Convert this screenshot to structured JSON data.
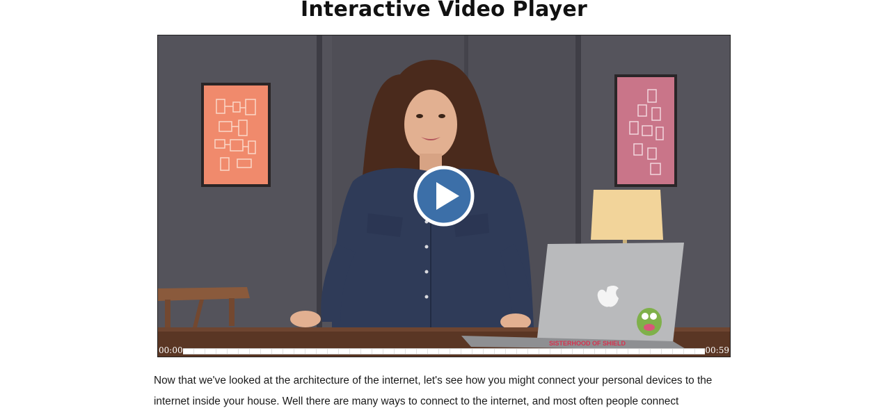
{
  "page": {
    "title": "Interactive Video Player"
  },
  "player": {
    "time_current": "00:00",
    "time_total": "00:59",
    "progress_fraction": 0,
    "play_icon": "play-icon",
    "sticker_text": "SISTERHOOD OF SHIELD"
  },
  "transcript": {
    "text": "Now that we've looked at the architecture of the internet, let's see how you might connect your personal devices to the internet inside your house. Well there are many ways to connect to the internet, and most often people connect"
  },
  "colors": {
    "accent": "#3c6fa8",
    "wall": "#4e4d55",
    "desk": "#5a3624"
  }
}
